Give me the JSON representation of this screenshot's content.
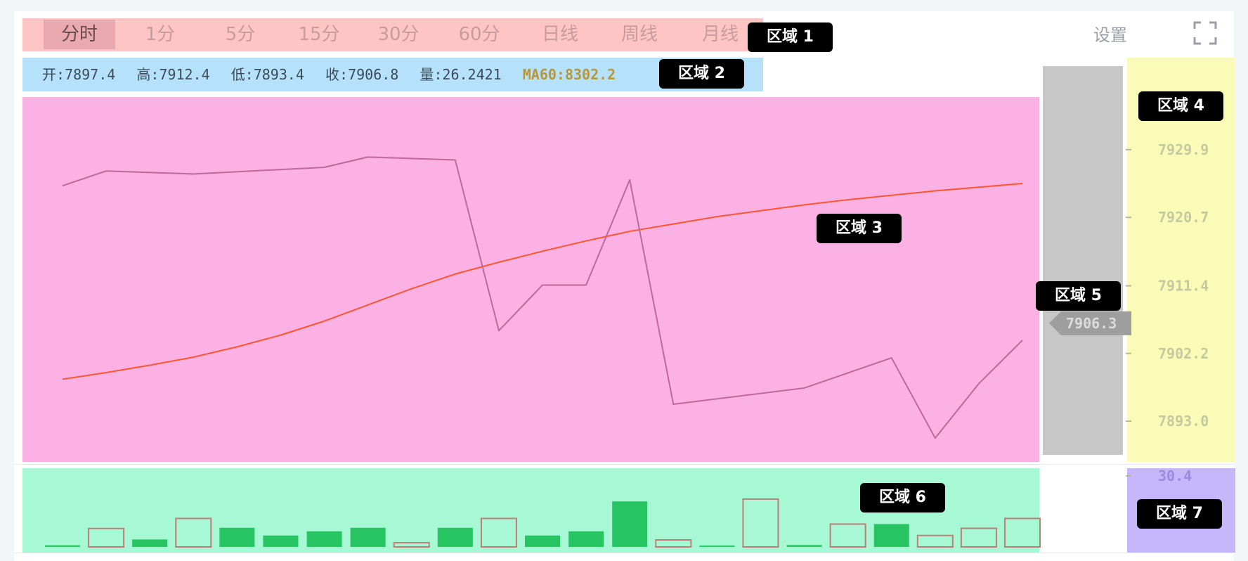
{
  "periods": [
    "分时",
    "1分",
    "5分",
    "15分",
    "30分",
    "60分",
    "日线",
    "周线",
    "月线"
  ],
  "active_period": "分时",
  "settings_label": "设置",
  "fullscreen_icon": "fullscreen-icon",
  "info": {
    "open": "开:7897.4",
    "high": "高:7912.4",
    "low": "低:7893.4",
    "close": "收:7906.8",
    "volume": "量:26.2421",
    "ma": "MA60:8302.2"
  },
  "region_labels": {
    "r1": "区域 1",
    "r2": "区域 2",
    "r3": "区域 3",
    "r4": "区域 4",
    "r5": "区域 5",
    "r6": "区域 6",
    "r7": "区域 7"
  },
  "colors": {
    "price_line": "#c0679c",
    "ma_line": "#ff5530",
    "vol_up": "#27c562",
    "vol_down_stroke": "#c07d78",
    "axis_text": "#c7c7a0",
    "vol_axis_text": "#9b8ae0",
    "current_tag": "#9e9e9e"
  },
  "chart_data": [
    {
      "type": "line",
      "x": [
        0,
        1,
        2,
        3,
        4,
        5,
        6,
        7,
        8,
        9,
        10,
        11,
        12,
        13,
        14,
        15,
        16,
        17,
        18,
        19,
        20,
        21,
        22
      ],
      "series": [
        {
          "values": [
            7925.0,
            7927.0,
            null,
            7926.6,
            null,
            null,
            7927.5,
            7928.9,
            null,
            7928.5,
            7905.3,
            7911.5,
            7911.5,
            7925.8,
            7895.3,
            null,
            null,
            7897.5,
            null,
            7901.6,
            7890.7,
            7898.1,
            7904.0
          ]
        },
        {
          "values": [
            7898.7,
            7899.6,
            7900.6,
            7901.7,
            7903.1,
            7904.7,
            7906.6,
            7908.8,
            7911.0,
            7913.0,
            7914.6,
            7916.1,
            7917.5,
            7918.8,
            7919.8,
            7920.8,
            7921.6,
            7922.4,
            7923.1,
            7923.7,
            7924.3,
            7924.8,
            7925.3
          ]
        }
      ],
      "y_ticks": [
        "7929.9",
        "7920.7",
        "7911.4",
        "7902.2",
        "7893.0"
      ],
      "ylim": [
        7891.0,
        7934.0
      ],
      "current_value": "7906.3"
    },
    {
      "type": "bar",
      "x": [
        0,
        1,
        2,
        3,
        4,
        5,
        6,
        7,
        8,
        9,
        10,
        11,
        12,
        13,
        14,
        15,
        16,
        17,
        18,
        19,
        20,
        21,
        22
      ],
      "values": [
        0.7,
        7.9,
        3.2,
        12.2,
        8.2,
        4.9,
        6.7,
        8.2,
        1.8,
        8.2,
        12.2,
        4.9,
        6.7,
        19.5,
        3.0,
        0.4,
        20.5,
        0.8,
        9.8,
        9.8,
        4.9,
        8.0,
        12.2
      ],
      "up": [
        true,
        false,
        true,
        false,
        true,
        true,
        true,
        true,
        false,
        true,
        false,
        true,
        true,
        true,
        false,
        true,
        false,
        true,
        false,
        true,
        false,
        false,
        false
      ],
      "y_ticks": [
        "30.4"
      ],
      "ylim": [
        0,
        30.4
      ]
    }
  ]
}
